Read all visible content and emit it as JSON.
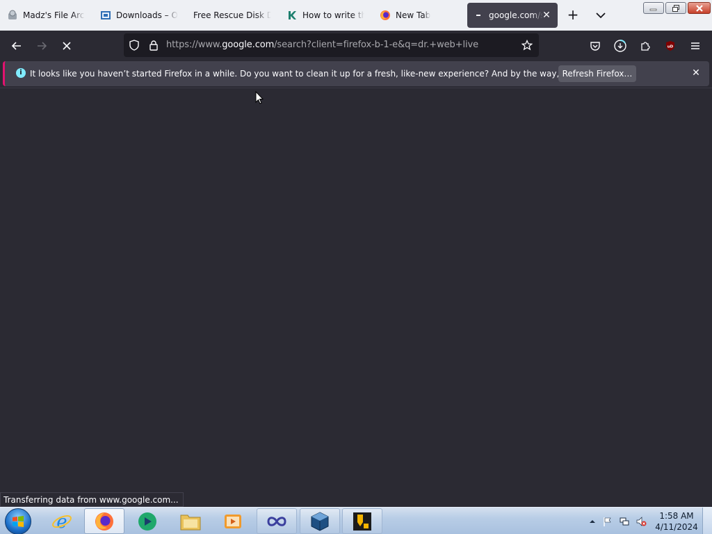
{
  "tabs": [
    {
      "title": "Madz's File Archi",
      "icon": "archive-icon"
    },
    {
      "title": "Downloads – Ora",
      "icon": "downloads-site-icon"
    },
    {
      "title": "Free Rescue Disk Dov",
      "icon": "none"
    },
    {
      "title": "How to write the",
      "icon": "k-site-icon"
    },
    {
      "title": "New Tab",
      "icon": "firefox-icon"
    },
    {
      "title": "google.com/s",
      "icon": "loading-icon",
      "active": true
    }
  ],
  "url": {
    "scheme": "https://www.",
    "host": "google.com",
    "path": "/search?client=firefox-b-1-e&q=dr.+web+live"
  },
  "notification": {
    "message": "It looks like you haven’t started Firefox in a while. Do you want to clean it up for a fresh, like-new experience? And by the way, welcome back!",
    "refresh_label": "Refresh Firefox…"
  },
  "status_text": "Transferring data from www.google.com...",
  "clock": {
    "time": "1:58 AM",
    "date": "4/11/2024"
  },
  "colors": {
    "accent": "#e2126f",
    "info": "#80ebff",
    "background": "#2b2a33",
    "toolbar": "#42414d"
  }
}
